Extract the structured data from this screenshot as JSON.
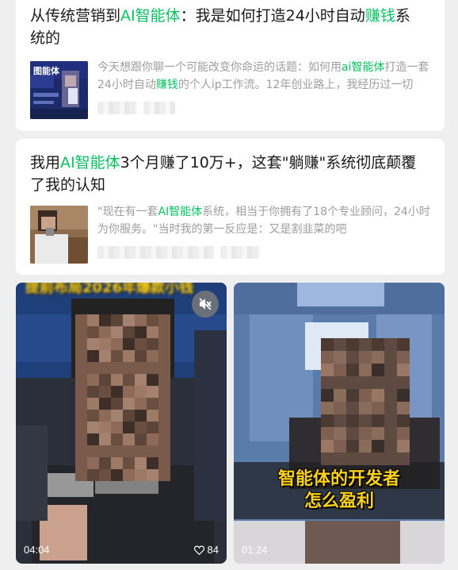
{
  "articles": [
    {
      "title_parts": [
        {
          "text": "从传统营销到",
          "hl": false
        },
        {
          "text": "AI智能体",
          "hl": true
        },
        {
          "text": "：我是如何打造24小时自动",
          "hl": false
        },
        {
          "text": "赚钱",
          "hl": true
        },
        {
          "text": "系统的",
          "hl": false
        }
      ],
      "desc_parts": [
        {
          "text": "今天想跟你聊一个可能改变你命运的话题：如何用",
          "hl": false
        },
        {
          "text": "ai智能体",
          "hl": true
        },
        {
          "text": "打造一套24小时自动",
          "hl": false
        },
        {
          "text": "赚钱",
          "hl": true
        },
        {
          "text": "的个人ip工作流。12年创业路上，我经历过一切",
          "hl": false
        }
      ]
    },
    {
      "title_parts": [
        {
          "text": "我用",
          "hl": false
        },
        {
          "text": "AI智能体",
          "hl": true
        },
        {
          "text": "3个月赚了10万+，这套\"躺赚\"系统彻底颠覆了我的认知",
          "hl": false
        }
      ],
      "desc_parts": [
        {
          "text": "\"现在有一套",
          "hl": false
        },
        {
          "text": "AI智能体",
          "hl": true
        },
        {
          "text": "系统，相当于你拥有了18个专业顾问，24小时为你服务。\"当时我的第一反应是：又是割韭菜的吧",
          "hl": false
        }
      ]
    }
  ],
  "videos": [
    {
      "duration": "04:04",
      "likes": "84",
      "mute_icon": "speaker-muted-icon",
      "like_icon": "heart-icon"
    },
    {
      "duration": "01:24",
      "caption_line1": "智能体的开发者",
      "caption_line2": "怎么盈利"
    }
  ],
  "colors": {
    "highlight": "#07c160",
    "caption": "#ffd21a",
    "background": "#efefef"
  }
}
